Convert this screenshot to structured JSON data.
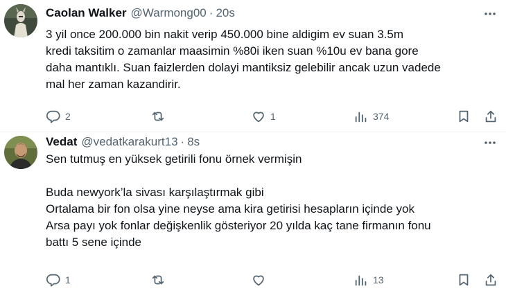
{
  "tweets": [
    {
      "name": "Caolan Walker",
      "handle": "@Warmong00",
      "separator": "·",
      "time": "20s",
      "lines": [
        "3 yil once  200.000 bin nakit verip 450.000 bine aldigim ev suan 3.5m",
        "kredi taksitim o zamanlar maasimin %80i iken suan %10u ev bana gore",
        "daha mantıklı. Suan faizlerden dolayi mantiksiz gelebilir ancak uzun vadede",
        "mal her zaman kazandirir."
      ],
      "stats": {
        "replies": "2",
        "reposts": "",
        "likes": "1",
        "views": "374"
      }
    },
    {
      "name": "Vedat",
      "handle": "@vedatkarakurt13",
      "separator": "·",
      "time": "8s",
      "lines": [
        "Sen tutmuş en yüksek getirili fonu örnek vermişin",
        "",
        "Buda newyork’la sivası karşılaştırmak gibi",
        "Ortalama bir fon olsa yine neyse ama kira getirisi hesapların içinde yok",
        "Arsa payı yok fonlar değişkenlik gösteriyor 20 yılda kaç tane firmanın fonu",
        "battı 5 sene içinde"
      ],
      "stats": {
        "replies": "1",
        "reposts": "",
        "likes": "",
        "views": "13"
      }
    }
  ],
  "icons": {
    "reply": "reply-icon",
    "repost": "repost-icon",
    "like": "heart-icon",
    "views": "views-icon",
    "bookmark": "bookmark-icon",
    "share": "share-icon",
    "more": "more-icon"
  },
  "colors": {
    "text": "#0f1419",
    "secondary": "#536471",
    "divider": "#eff3f4"
  }
}
